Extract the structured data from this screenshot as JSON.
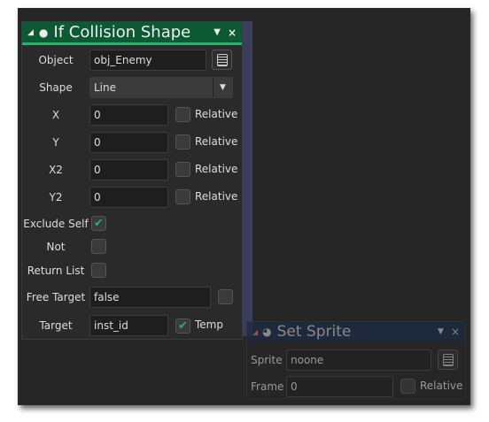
{
  "main_panel": {
    "title": "If Collision Shape",
    "object": {
      "label": "Object",
      "value": "obj_Enemy"
    },
    "shape": {
      "label": "Shape",
      "value": "Line"
    },
    "coords": [
      {
        "label": "X",
        "value": "0",
        "relative_label": "Relative",
        "relative": false
      },
      {
        "label": "Y",
        "value": "0",
        "relative_label": "Relative",
        "relative": false
      },
      {
        "label": "X2",
        "value": "0",
        "relative_label": "Relative",
        "relative": false
      },
      {
        "label": "Y2",
        "value": "0",
        "relative_label": "Relative",
        "relative": false
      }
    ],
    "exclude_self": {
      "label": "Exclude Self",
      "checked": true
    },
    "not": {
      "label": "Not",
      "checked": false
    },
    "return_list": {
      "label": "Return List",
      "checked": false
    },
    "free_target": {
      "label": "Free Target",
      "value": "false",
      "checked": false
    },
    "target": {
      "label": "Target",
      "value": "inst_id",
      "temp_label": "Temp",
      "temp": true
    }
  },
  "set_sprite_panel": {
    "title": "Set Sprite",
    "sprite": {
      "label": "Sprite",
      "value": "noone"
    },
    "frame": {
      "label": "Frame",
      "value": "0",
      "relative_label": "Relative"
    }
  },
  "colors": {
    "header": "#0b5a34",
    "accent": "#2bb06a",
    "ghost_header": "#1d2a44"
  }
}
